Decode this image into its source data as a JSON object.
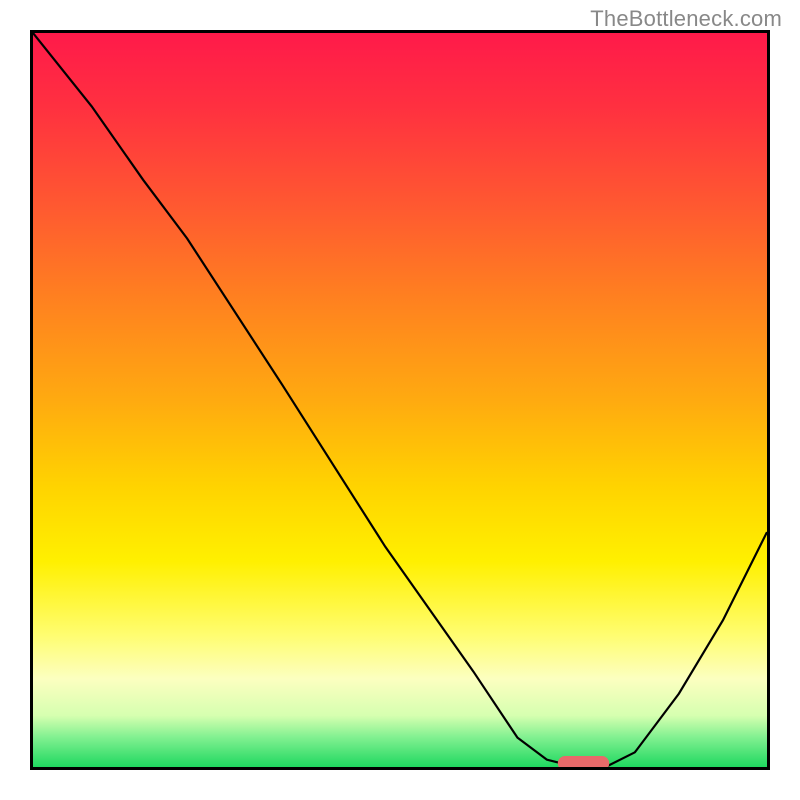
{
  "watermark": "TheBottleneck.com",
  "colors": {
    "gradient_top": "#ff1a4a",
    "gradient_bottom": "#1fd860",
    "curve": "#000000",
    "marker": "#e86a6a",
    "border": "#000000",
    "watermark_text": "#888888"
  },
  "chart_data": {
    "type": "line",
    "title": "",
    "xlabel": "",
    "ylabel": "",
    "xlim": [
      0,
      100
    ],
    "ylim": [
      0,
      100
    ],
    "grid": false,
    "legend": false,
    "series": [
      {
        "name": "bottleneck-curve",
        "x": [
          0,
          8,
          15,
          21,
          34,
          48,
          60,
          66,
          70,
          74,
          78,
          82,
          88,
          94,
          100
        ],
        "y": [
          100,
          90,
          80,
          72,
          52,
          30,
          13,
          4,
          1,
          0,
          0,
          2,
          10,
          20,
          32
        ]
      }
    ],
    "annotations": [
      {
        "name": "optimal-marker",
        "shape": "rounded-rect",
        "x_center": 75,
        "y_center": 0.5,
        "width": 7,
        "height": 2
      }
    ],
    "background_gradient": {
      "orientation": "vertical",
      "stops": [
        {
          "pos": 0.0,
          "color": "#ff1a4a"
        },
        {
          "pos": 0.1,
          "color": "#ff3040"
        },
        {
          "pos": 0.24,
          "color": "#ff5a30"
        },
        {
          "pos": 0.36,
          "color": "#ff8020"
        },
        {
          "pos": 0.5,
          "color": "#ffaa10"
        },
        {
          "pos": 0.62,
          "color": "#ffd400"
        },
        {
          "pos": 0.72,
          "color": "#fff000"
        },
        {
          "pos": 0.82,
          "color": "#fffd70"
        },
        {
          "pos": 0.88,
          "color": "#fcffc0"
        },
        {
          "pos": 0.93,
          "color": "#d6ffb0"
        },
        {
          "pos": 0.96,
          "color": "#80f090"
        },
        {
          "pos": 1.0,
          "color": "#1fd860"
        }
      ]
    }
  }
}
